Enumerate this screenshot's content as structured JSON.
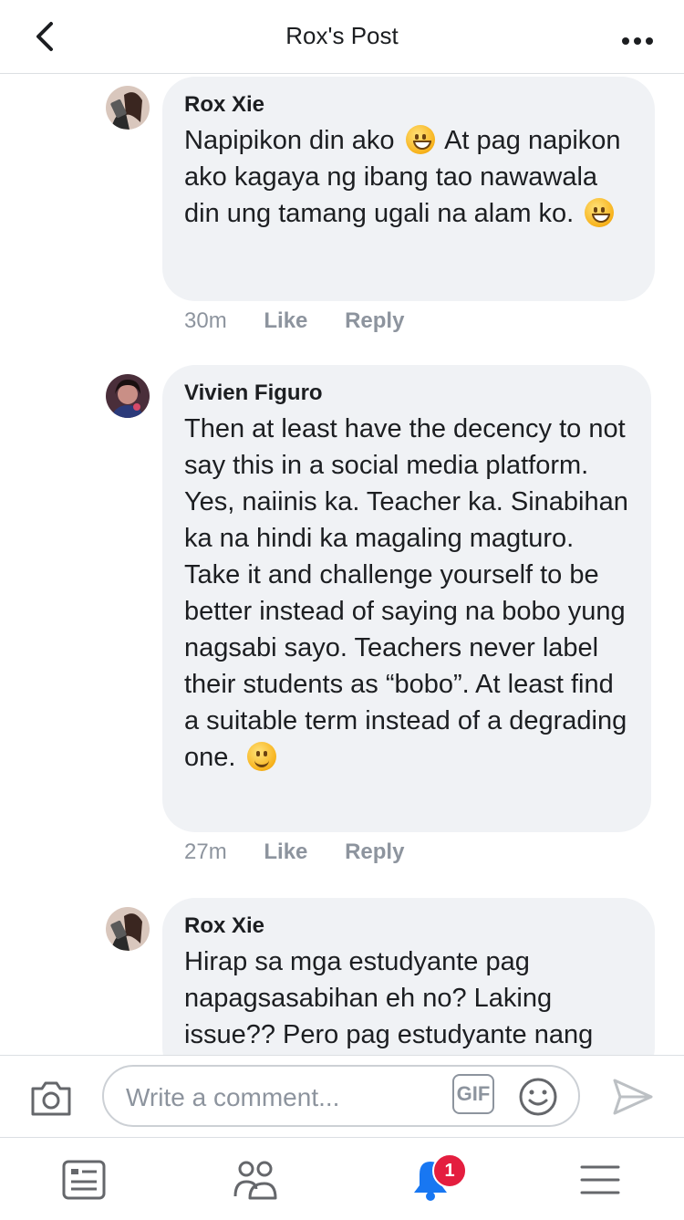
{
  "header": {
    "title": "Rox's Post",
    "back_icon": "chevron-left-icon",
    "more_icon": "more-dots-icon"
  },
  "comments": [
    {
      "author": "Rox Xie",
      "text_part1": "Napipikon din ako",
      "emoji1": "grinning-face",
      "text_part2": "At pag napikon ako kagaya ng ibang tao nawawala din ung tamang ugali na alam ko.",
      "emoji2": "grinning-face",
      "time": "30m",
      "like_label": "Like",
      "reply_label": "Reply"
    },
    {
      "author": "Vivien Figuro",
      "text": "Then at least have the decency to not say this in a social media platform. Yes, naiinis ka. Teacher ka. Sinabihan ka na hindi ka magaling magturo. Take it and challenge yourself to be better instead of saying na bobo yung nagsabi sayo. Teachers never label their students as “bobo”. At least find a suitable term instead of a degrading one.",
      "emoji": "slightly-smiling-face",
      "time": "27m",
      "like_label": "Like",
      "reply_label": "Reply"
    },
    {
      "author": "Rox Xie",
      "text": "Hirap sa mga estudyante pag napagsasabihan eh no? Laking issue?? Pero pag estudyante nang"
    }
  ],
  "composer": {
    "placeholder": "Write a comment...",
    "gif_label": "GIF",
    "camera_icon": "camera-icon",
    "smile_icon": "smiley-icon",
    "send_icon": "send-icon"
  },
  "bottom_nav": {
    "items": [
      "news-feed-icon",
      "friends-icon",
      "notifications-bell-icon",
      "menu-icon"
    ],
    "notification_count": "1"
  },
  "colors": {
    "bubble": "#f0f2f5",
    "notification_blue": "#1877f2",
    "badge_red": "#e41e3f",
    "secondary_text": "#8d949e"
  }
}
